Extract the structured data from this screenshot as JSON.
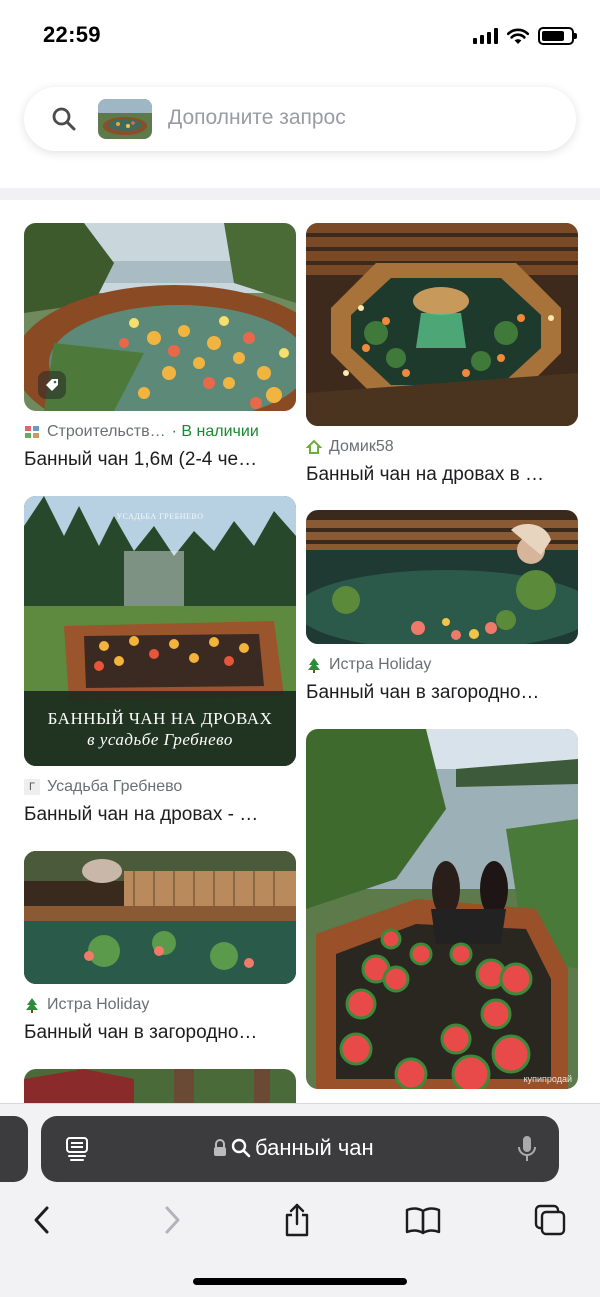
{
  "status": {
    "time": "22:59",
    "battery_level": 0.8
  },
  "search": {
    "placeholder": "Дополните запрос"
  },
  "results": [
    {
      "source": "Строительств…",
      "stock": "· В наличии",
      "title": "Банный чан 1,6м (2-4 че…"
    },
    {
      "source": "Домик58",
      "title": "Банный чан на дровах в …"
    },
    {
      "source": "Усадьба Гребнево",
      "title": "Банный чан на дровах - …",
      "overlay_line1": "БАННЫЙ ЧАН НА ДРОВАХ",
      "overlay_line2": "в усадьбе Гребнево",
      "overlay_top": "УСАДЬБА ГРЕБНЕВО"
    },
    {
      "source": "Истра Holiday",
      "title": "Банный чан в загородно…"
    },
    {
      "source": "Истра Holiday",
      "title": "Банный чан в загородно…"
    },
    {
      "watermark": "купипродай"
    }
  ],
  "browser": {
    "url_text": "банный чан"
  },
  "icons": {
    "search": "search-icon",
    "tag": "tag-icon",
    "home": "house-icon",
    "tree": "tree-icon",
    "tabs": "tab-overview-icon",
    "lock": "lock-icon",
    "mic": "microphone-icon",
    "back": "chevron-left-icon",
    "forward": "chevron-right-icon",
    "share": "share-icon",
    "bookmarks": "book-icon",
    "pages": "tabs-icon"
  },
  "colors": {
    "stock": "#198a2e",
    "url_bar": "#3c3c3e",
    "source_text": "#6b6e74"
  }
}
